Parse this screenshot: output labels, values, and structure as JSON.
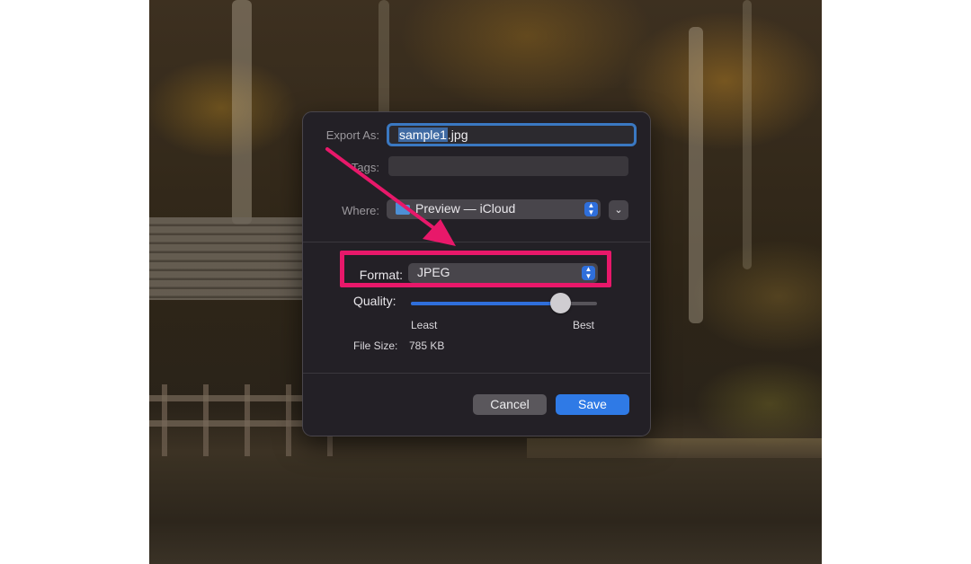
{
  "dialog": {
    "export_as_label": "Export As:",
    "filename_selected": "sample1",
    "filename_ext": ".jpg",
    "tags_label": "Tags:",
    "tags_value": "",
    "where_label": "Where:",
    "where_value": "Preview — iCloud",
    "format_label": "Format:",
    "format_value": "JPEG",
    "quality_label": "Quality:",
    "quality_level": 0.8,
    "quality_min_label": "Least",
    "quality_max_label": "Best",
    "file_size_label": "File Size:",
    "file_size_value": "785 KB",
    "cancel_label": "Cancel",
    "save_label": "Save"
  },
  "annotation": {
    "highlight_color": "#e8186a",
    "accent_color": "#2f7ae6"
  },
  "icons": {
    "folder": "folder-icon",
    "stepper": "updown-chevron-icon",
    "disclosure": "chevron-down-icon"
  }
}
